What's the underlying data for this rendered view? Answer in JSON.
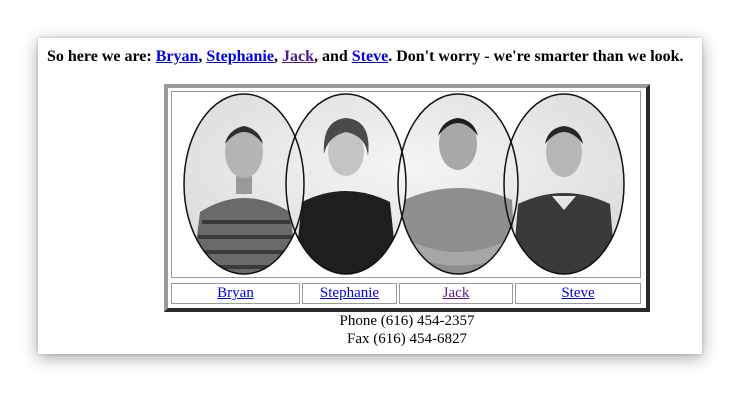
{
  "intro": {
    "prefix": "So here we are: ",
    "names": [
      "Bryan",
      "Stephanie",
      "Jack",
      "Steve"
    ],
    "sep1": ", ",
    "sep2": ", ",
    "sep3": ", and ",
    "suffix": ". Don't worry - we're smarter than we look."
  },
  "team": [
    {
      "name": "Bryan",
      "visited": false
    },
    {
      "name": "Stephanie",
      "visited": false
    },
    {
      "name": "Jack",
      "visited": true
    },
    {
      "name": "Steve",
      "visited": false
    }
  ],
  "contact": {
    "phone": "Phone (616) 454-2357",
    "fax": "Fax (616) 454-6827"
  },
  "colors": {
    "link": "#0000ee",
    "visited_link": "#551a8b"
  },
  "icons": {
    "photo": "team-photo-icon"
  }
}
